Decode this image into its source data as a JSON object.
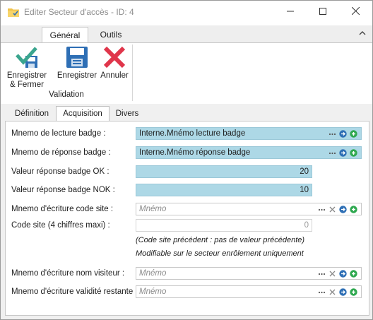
{
  "window": {
    "title": "Editer Secteur d'accès - ID: 4"
  },
  "ribbon": {
    "tabs": [
      {
        "label": "Général",
        "active": true
      },
      {
        "label": "Outils",
        "active": false
      }
    ],
    "buttons": {
      "save_close_line1": "Enregistrer",
      "save_close_line2": "& Fermer",
      "save": "Enregistrer",
      "cancel": "Annuler"
    },
    "group_label": "Validation"
  },
  "content_tabs": [
    {
      "label": "Définition",
      "active": false
    },
    {
      "label": "Acquisition",
      "active": true
    },
    {
      "label": "Divers",
      "active": false
    }
  ],
  "form": {
    "read_badge_label": "Mnemo de lecture badge :",
    "read_badge_value": "Interne.Mnémo lecture badge",
    "resp_badge_label": "Mnemo de réponse badge :",
    "resp_badge_value": "Interne.Mnémo réponse badge",
    "ok_label": "Valeur réponse badge OK :",
    "ok_value": "20",
    "nok_label": "Valeur réponse badge NOK :",
    "nok_value": "10",
    "write_site_label": "Mnemo d'écriture code site :",
    "write_site_placeholder": "Mnémo",
    "site_code_label": "Code site (4 chiffres maxi) :",
    "site_code_value": "0",
    "site_prev_note": "(Code site précédent : pas de valeur précédente)",
    "site_modif_note": "Modifiable sur le secteur enrôlement uniquement",
    "write_name_label": "Mnemo d'écriture nom visiteur :",
    "write_name_placeholder": "Mnémo",
    "write_validity_label": "Mnemo d'écriture validité restante :",
    "write_validity_placeholder": "Mnémo"
  },
  "colors": {
    "blue_field": "#add8e6",
    "save_close_check": "#3aa58e",
    "save_disk": "#2e6fb5",
    "cancel_x": "#e0364b",
    "go_icon": "#2e6fb5",
    "add_icon": "#2ea84f"
  }
}
